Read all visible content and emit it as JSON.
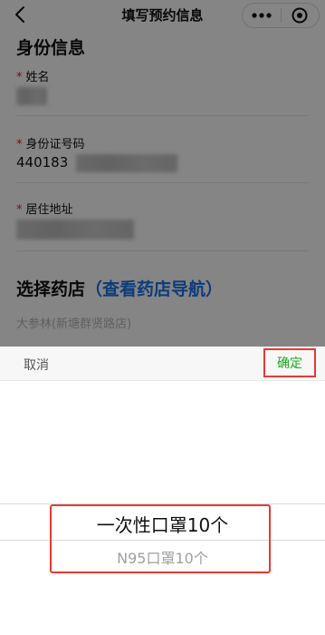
{
  "nav": {
    "title": "填写预约信息",
    "back_icon": "chevron-left-icon",
    "more_icon": "more-dots-icon",
    "close_icon": "target-circle-icon"
  },
  "identity": {
    "section_title": "身份信息",
    "required_mark": "*",
    "name_label": "姓名",
    "id_label": "身份证号码",
    "id_value_visible": "440183",
    "address_label": "居住地址"
  },
  "pharmacy": {
    "title": "选择药店",
    "nav_link": "（查看药店导航）",
    "selected_store": "大参林(新塘群贤路店)"
  },
  "picker": {
    "cancel_label": "取消",
    "confirm_label": "确定",
    "options": [
      "一次性口罩10个",
      "N95口罩10个"
    ],
    "selected_index": 0
  },
  "colors": {
    "accent_green": "#1aad19",
    "link_blue": "#1a73e8",
    "required_red": "#e02020",
    "annotation_red": "#e53935"
  }
}
